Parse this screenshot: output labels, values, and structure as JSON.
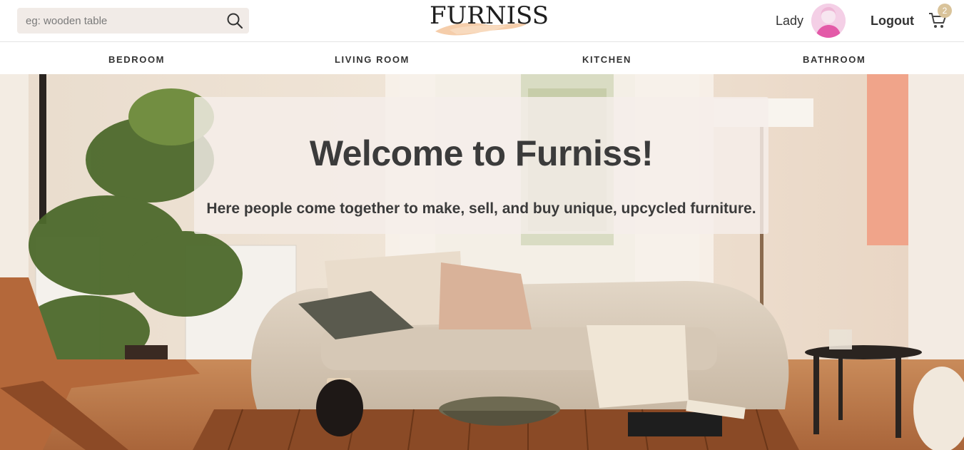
{
  "search": {
    "placeholder": "eg: wooden table",
    "icon": "search-icon"
  },
  "logo": {
    "text": "FURNISS",
    "accent_color": "#f0a878"
  },
  "user": {
    "name": "Lady",
    "avatar": "avatar-icon"
  },
  "logout_label": "Logout",
  "cart": {
    "count": "2",
    "icon": "cart-icon",
    "badge_color": "#d9c39a"
  },
  "nav": {
    "items": [
      {
        "label": "BEDROOM"
      },
      {
        "label": "LIVING ROOM"
      },
      {
        "label": "KITCHEN"
      },
      {
        "label": "BATHROOM"
      }
    ]
  },
  "hero": {
    "title": "Welcome to Furniss!",
    "subtitle": "Here people come together to make, sell, and buy unique, upcycled furniture."
  }
}
